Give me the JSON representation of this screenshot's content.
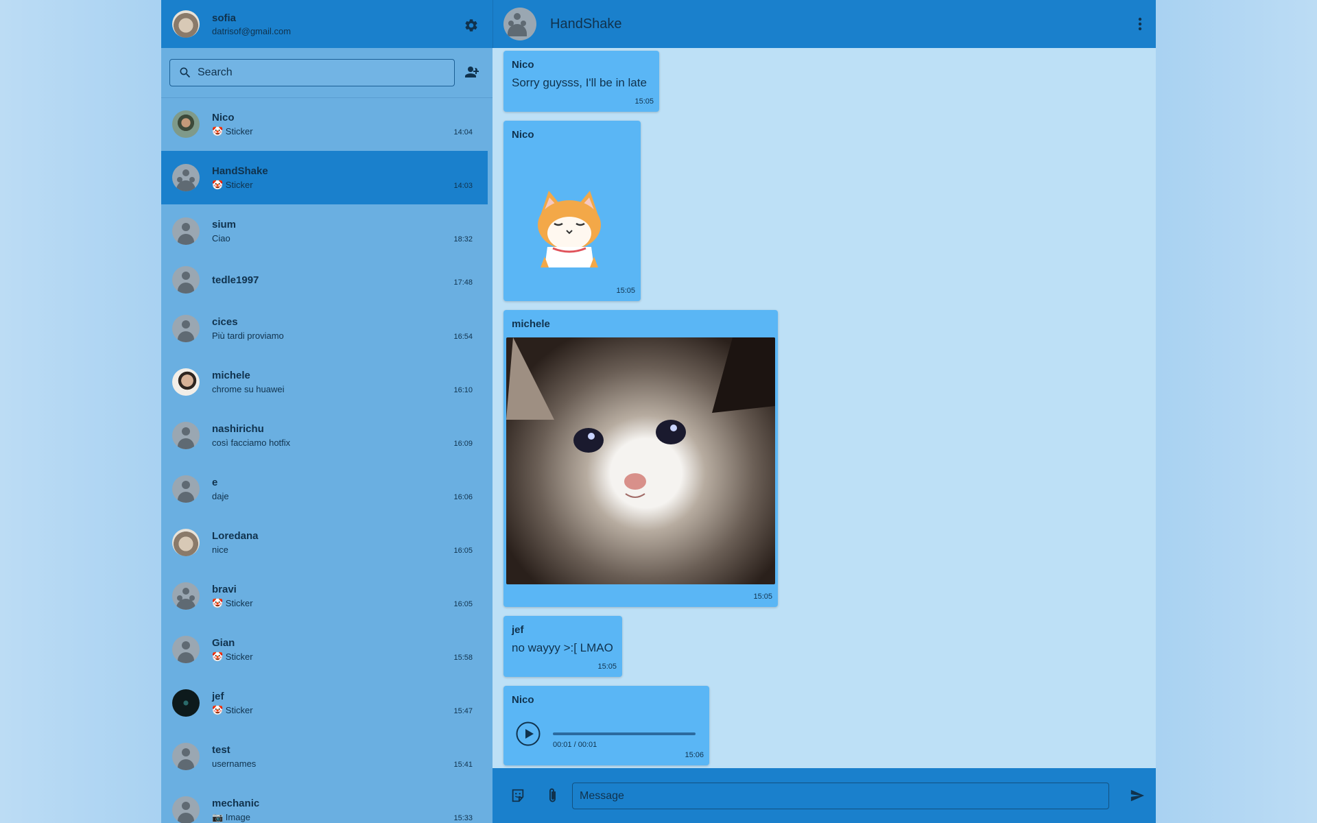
{
  "profile": {
    "name": "sofia",
    "email": "datrisof@gmail.com"
  },
  "search": {
    "placeholder": "Search"
  },
  "chats": [
    {
      "name": "Nico",
      "preview": "🤡 Sticker",
      "time": "14:04"
    },
    {
      "name": "HandShake",
      "preview": "🤡 Sticker",
      "time": "14:03"
    },
    {
      "name": "sium",
      "preview": "Ciao",
      "time": "18:32"
    },
    {
      "name": "tedle1997",
      "preview": "",
      "time": "17:48"
    },
    {
      "name": "cices",
      "preview": "Più tardi proviamo",
      "time": "16:54"
    },
    {
      "name": "michele",
      "preview": "chrome su huawei",
      "time": "16:10"
    },
    {
      "name": "nashirichu",
      "preview": "così facciamo hotfix",
      "time": "16:09"
    },
    {
      "name": "e",
      "preview": "daje",
      "time": "16:06"
    },
    {
      "name": "Loredana",
      "preview": "nice",
      "time": "16:05"
    },
    {
      "name": "bravi",
      "preview": "🤡 Sticker",
      "time": "16:05"
    },
    {
      "name": "Gian",
      "preview": "🤡 Sticker",
      "time": "15:58"
    },
    {
      "name": "jef",
      "preview": "🤡 Sticker",
      "time": "15:47"
    },
    {
      "name": "test",
      "preview": "usernames",
      "time": "15:41"
    },
    {
      "name": "mechanic",
      "preview": "📷 Image",
      "time": "15:33"
    }
  ],
  "conversation": {
    "title": "HandShake",
    "messages": [
      {
        "sender": "Nico",
        "text": "Sorry guysss, I'll be in late",
        "time": "15:05"
      },
      {
        "sender": "Nico",
        "kind": "sticker",
        "time": "15:05"
      },
      {
        "sender": "michele",
        "kind": "image",
        "time": "15:05"
      },
      {
        "sender": "jef",
        "text": "no wayyy >:[ LMAO",
        "time": "15:05"
      },
      {
        "sender": "Nico",
        "kind": "audio",
        "audio_time": "00:01 / 00:01",
        "audio_progress": 0,
        "time": "15:06"
      }
    ]
  },
  "composer": {
    "placeholder": "Message"
  },
  "colors": {
    "header": "#1a80cc",
    "sidebar": "#6aafe1",
    "bubble": "#5ab6f5",
    "text": "#10324d"
  },
  "icons": [
    "gear-icon",
    "search-icon",
    "add-user-icon",
    "more-vert-icon",
    "sticker-icon",
    "paperclip-icon",
    "send-icon",
    "play-icon"
  ]
}
